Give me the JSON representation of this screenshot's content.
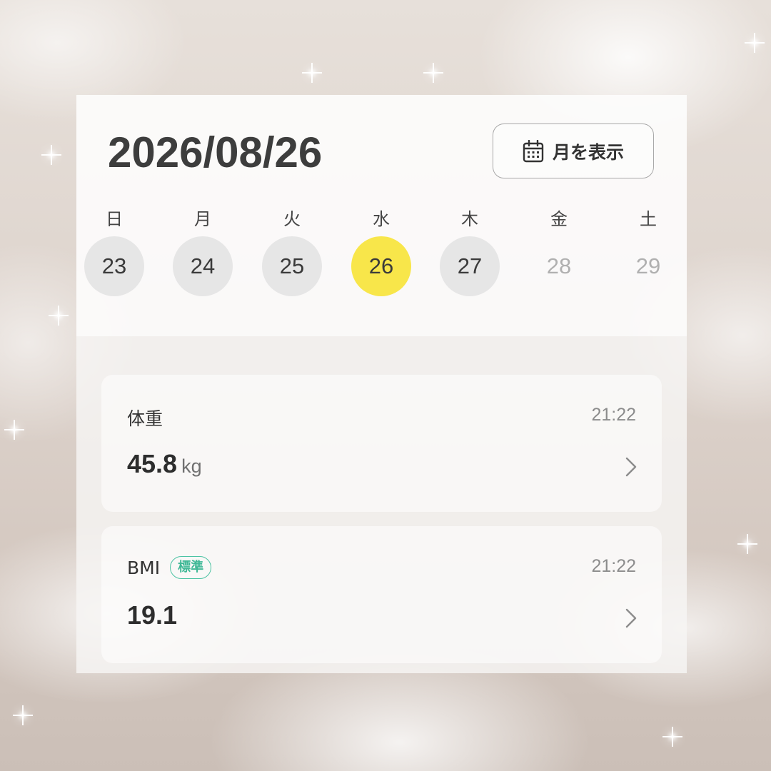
{
  "header": {
    "date": "2026/08/26",
    "month_button_label": "月を表示",
    "month_button_icon": "calendar-icon"
  },
  "week": {
    "days": [
      {
        "weekday": "日",
        "day": "23",
        "state": "past"
      },
      {
        "weekday": "月",
        "day": "24",
        "state": "past"
      },
      {
        "weekday": "火",
        "day": "25",
        "state": "past"
      },
      {
        "weekday": "水",
        "day": "26",
        "state": "selected"
      },
      {
        "weekday": "木",
        "day": "27",
        "state": "past"
      },
      {
        "weekday": "金",
        "day": "28",
        "state": "future"
      },
      {
        "weekday": "土",
        "day": "29",
        "state": "future"
      }
    ]
  },
  "metrics": [
    {
      "name": "体重",
      "time": "21:22",
      "value": "45.8",
      "unit": "kg",
      "badge": ""
    },
    {
      "name": "BMI",
      "time": "21:22",
      "value": "19.1",
      "unit": "",
      "badge": "標準"
    }
  ],
  "colors": {
    "selected_day": "#f8e64a",
    "past_day": "#e6e6e6",
    "badge": "#4cc3a3"
  }
}
